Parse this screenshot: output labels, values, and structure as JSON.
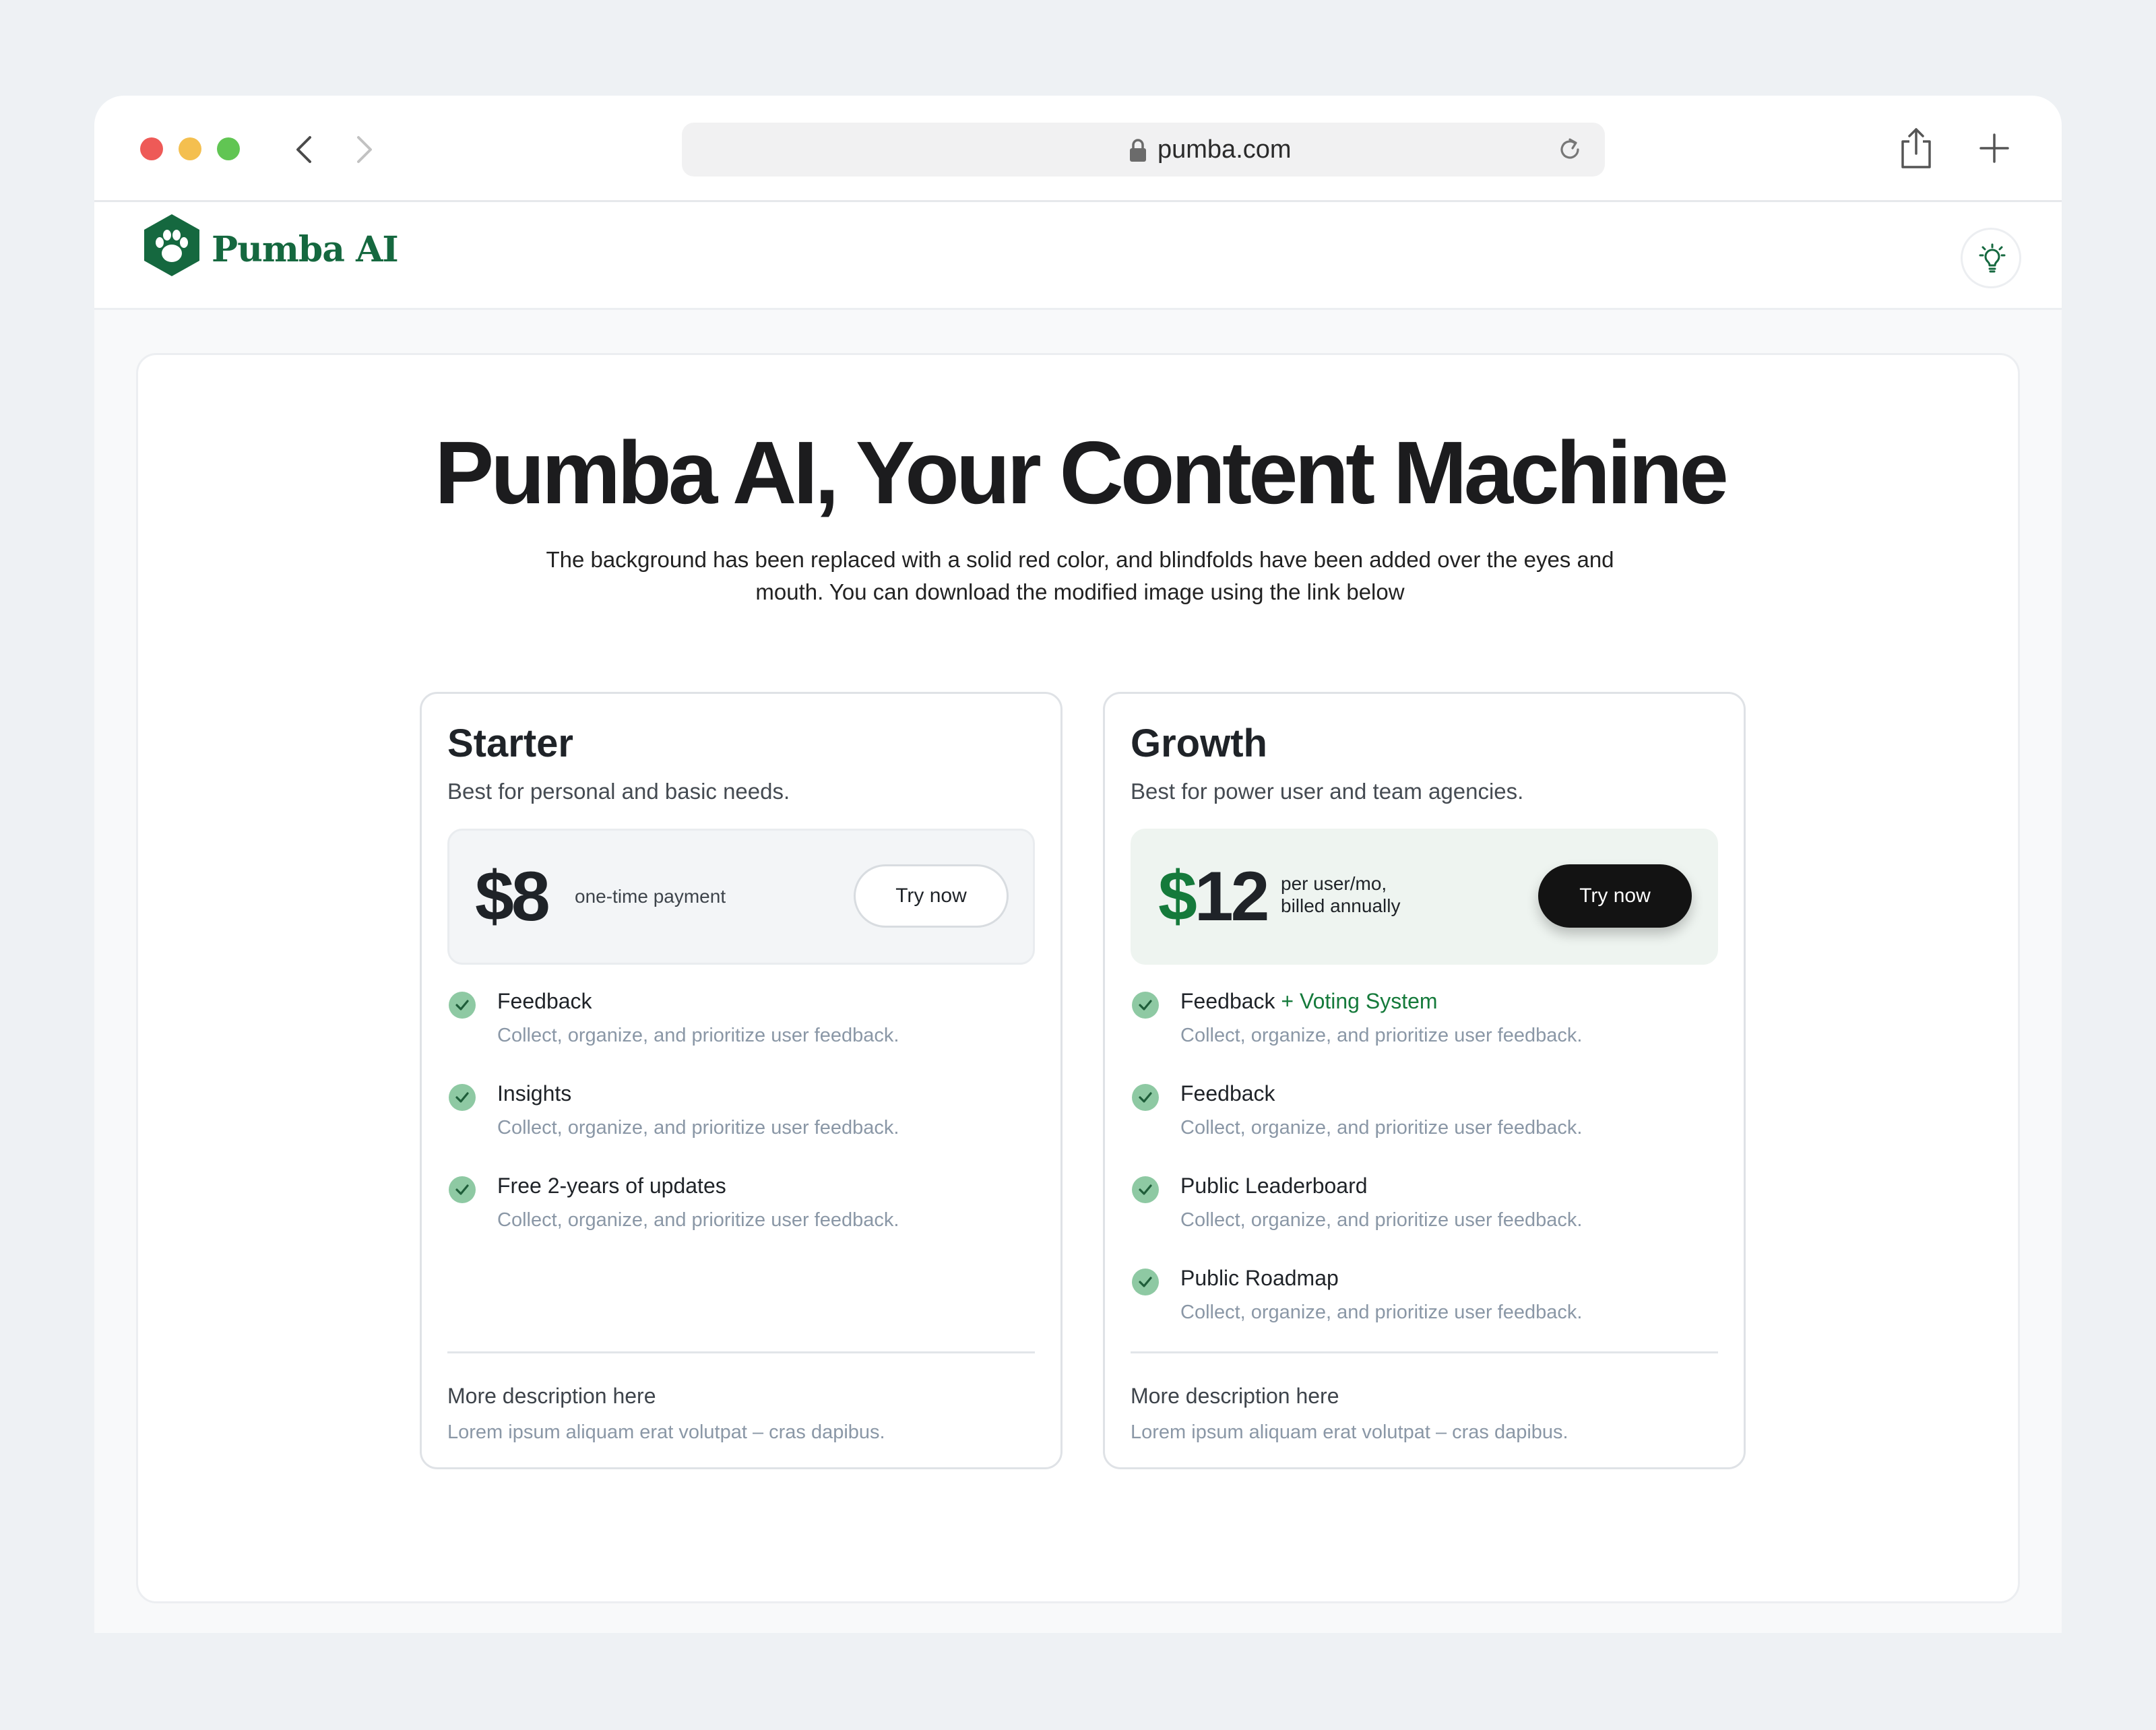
{
  "browser": {
    "url": "pumba.com",
    "icons": [
      "close-dot",
      "minimize-dot",
      "zoom-dot",
      "chevron-left-icon",
      "chevron-right-icon",
      "lock-icon",
      "reload-icon",
      "share-icon",
      "plus-icon"
    ]
  },
  "site": {
    "brand": "Pumba AI",
    "logo_icon": "paw-icon",
    "theme_icon": "lightbulb-icon",
    "brand_color": "#15683f"
  },
  "hero": {
    "title": "Pumba AI, Your Content Machine",
    "subtitle": "The background has been replaced with a solid red color, and blindfolds have been added over the eyes and mouth. You can download the modified image using the link below"
  },
  "plans": {
    "starter": {
      "name": "Starter",
      "description": "Best for personal and basic needs.",
      "price": "$8",
      "price_note": "one-time payment",
      "cta": "Try now",
      "features": [
        {
          "title": "Feedback",
          "desc": "Collect, organize, and prioritize user feedback."
        },
        {
          "title": "Insights",
          "desc": "Collect, organize, and prioritize user feedback."
        },
        {
          "title": "Free 2-years of updates",
          "desc": "Collect, organize, and prioritize user feedback."
        }
      ],
      "more_title": "More description here",
      "more_desc": "Lorem ipsum aliquam erat volutpat – cras dapibus."
    },
    "growth": {
      "name": "Growth",
      "description": "Best for power user and team agencies.",
      "price_currency": "$",
      "price_amount": "12",
      "price_note_line1": "per user/mo,",
      "price_note_line2": "billed annually",
      "cta": "Try now",
      "features": [
        {
          "title": "Feedback",
          "accent": "+ Voting System",
          "desc": "Collect, organize, and prioritize user feedback."
        },
        {
          "title": "Feedback",
          "desc": "Collect, organize, and prioritize user feedback."
        },
        {
          "title": "Public Leaderboard",
          "desc": "Collect, organize, and prioritize user feedback."
        },
        {
          "title": "Public Roadmap",
          "desc": "Collect, organize, and prioritize user feedback."
        }
      ],
      "more_title": "More description here",
      "more_desc": "Lorem ipsum aliquam erat volutpat – cras dapibus."
    }
  }
}
